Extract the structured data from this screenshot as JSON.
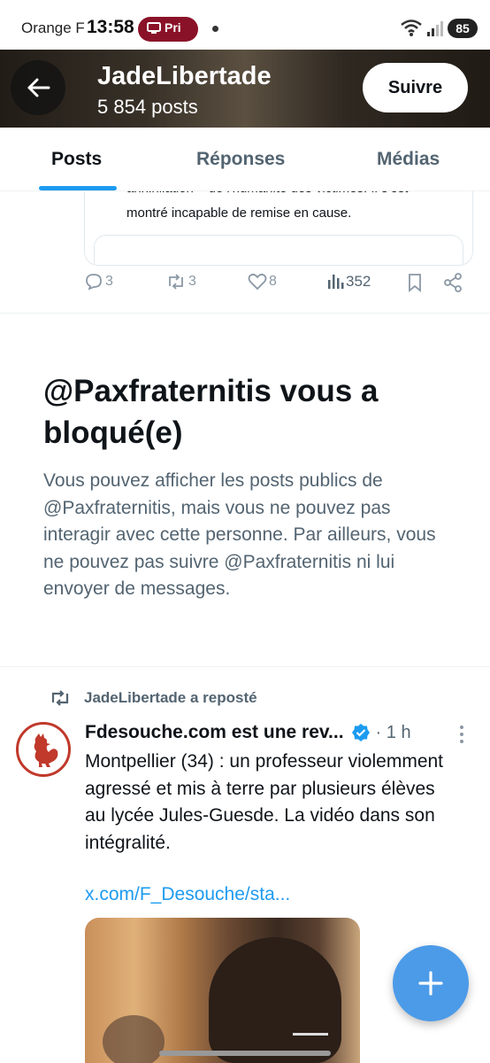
{
  "status_bar": {
    "carrier": "Orange F",
    "time": "13:58",
    "rec_label": "Pri",
    "battery": "85",
    "rec_color": "#8a1228"
  },
  "header": {
    "name": "JadeLibertade",
    "posts": "5 854 posts",
    "follow_label": "Suivre",
    "back_icon": "arrow-left-icon"
  },
  "tabs": [
    {
      "label": "Posts",
      "active": true
    },
    {
      "label": "Réponses",
      "active": false
    },
    {
      "label": "Médias",
      "active": false
    }
  ],
  "partial_tweet": {
    "line1": "annihilation » de l'humanité des victimes. Il s'est",
    "line2": "montré incapable de remise en cause.",
    "replies": "3",
    "reposts": "3",
    "likes": "8",
    "views": "352"
  },
  "blocked": {
    "title": "@Paxfraternitis vous a bloqué(e)",
    "body": "Vous pouvez afficher les posts publics de @Paxfraternitis, mais vous ne pouvez pas interagir avec cette personne. Par ailleurs, vous ne pouvez pas suivre @Paxfraternitis ni lui envoyer de messages."
  },
  "repost": {
    "label": "JadeLibertade a reposté"
  },
  "tweet": {
    "author": "Fdesouche.com est une rev...",
    "time": "· 1 h",
    "text": "Montpellier (34) : un professeur violemment agressé et mis à terre par plusieurs élèves au lycée Jules-Guesde. La vidéo dans son intégralité.",
    "link": "x.com/F_Desouche/sta..."
  },
  "colors": {
    "accent": "#1d9bf0",
    "secondary_text": "#536471",
    "fab": "#4c9be8"
  }
}
